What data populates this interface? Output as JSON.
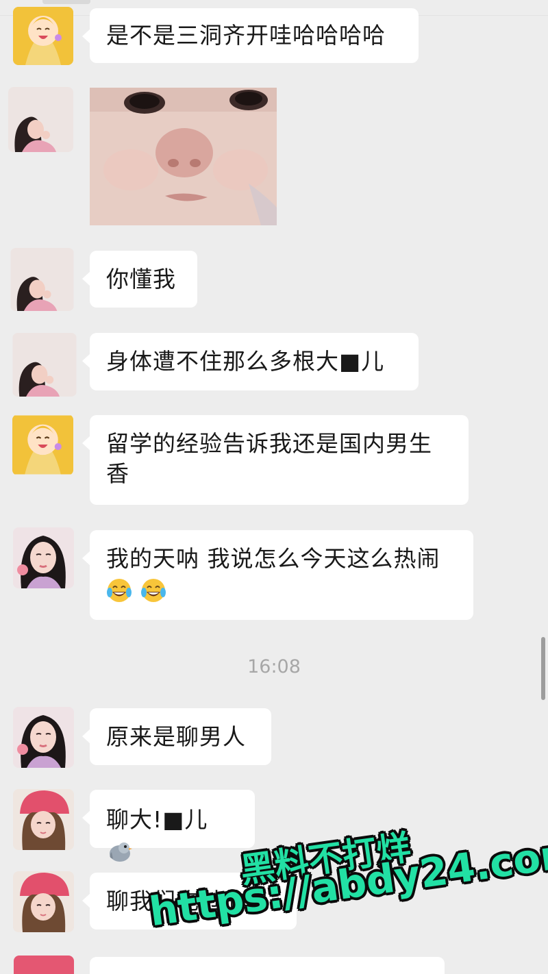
{
  "messages": [
    {
      "id": 1,
      "sender_avatar": "cartoon-girl-avatar",
      "text": "是不是三洞齐开哇哈哈哈哈"
    },
    {
      "id": 2,
      "sender_avatar": "girl-avatar-a",
      "type": "image",
      "image": "crying-baby-sticker"
    },
    {
      "id": 3,
      "sender_avatar": "girl-avatar-a",
      "text": "你懂我"
    },
    {
      "id": 4,
      "sender_avatar": "girl-avatar-a",
      "text": "身体遭不住那么多根大■儿"
    },
    {
      "id": 5,
      "sender_avatar": "cartoon-girl-avatar",
      "text": "留学的经验告诉我还是国内男生香"
    },
    {
      "id": 6,
      "sender_avatar": "girl-avatar-b",
      "text": "我的天呐 我说怎么今天这么热闹",
      "emojis": [
        "tears-of-joy-emoji",
        "tears-of-joy-emoji"
      ]
    },
    {
      "id": 7,
      "sender_avatar": "girl-avatar-b",
      "text": "原来是聊男人"
    },
    {
      "id": 8,
      "sender_avatar": "girl-avatar-c",
      "text": "聊大!■儿",
      "emojis": [
        "bird-emoji"
      ]
    },
    {
      "id": 9,
      "sender_avatar": "girl-avatar-c",
      "text": "聊我们吃过的鸡"
    }
  ],
  "timestamp": "16:08",
  "watermark": {
    "line1": "黑料不打烊",
    "line2": "https://abdy24.com"
  },
  "colors": {
    "background": "#ededed",
    "bubble": "#ffffff",
    "watermark": "#22e0a4"
  }
}
